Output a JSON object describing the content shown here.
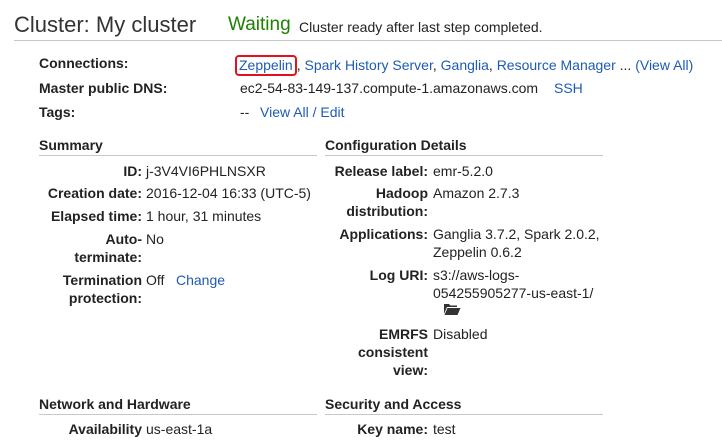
{
  "header": {
    "title": "Cluster: My cluster",
    "status": "Waiting",
    "status_message": "Cluster ready after last step completed.",
    "status_color": "#1d8102"
  },
  "connections": {
    "label": "Connections:",
    "links": [
      "Zeppelin",
      "Spark History Server",
      "Ganglia",
      "Resource Manager"
    ],
    "ellipsis": "...",
    "view_all": "(View All)",
    "highlight_color": "#e0121b"
  },
  "dns": {
    "label": "Master public DNS:",
    "value": "ec2-54-83-149-137.compute-1.amazonaws.com",
    "ssh": "SSH"
  },
  "tags": {
    "label": "Tags:",
    "value": "--",
    "link": "View All / Edit"
  },
  "summary": {
    "title": "Summary",
    "id_label": "ID:",
    "id_value": "j-3V4VI6PHLNSXR",
    "creation_label": "Creation date:",
    "creation_value": "2016-12-04 16:33 (UTC-5)",
    "elapsed_label": "Elapsed time:",
    "elapsed_value": "1 hour, 31 minutes",
    "autoterm_label_1": "Auto-",
    "autoterm_label_2": "terminate:",
    "autoterm_value": "No",
    "termprot_label_1": "Termination",
    "termprot_label_2": "protection:",
    "termprot_value": "Off",
    "termprot_change": "Change"
  },
  "config": {
    "title": "Configuration Details",
    "release_label": "Release label:",
    "release_value": "emr-5.2.0",
    "hadoop_label_1": "Hadoop",
    "hadoop_label_2": "distribution:",
    "hadoop_value": "Amazon 2.7.3",
    "apps_label": "Applications:",
    "apps_value_1": "Ganglia 3.7.2, Spark 2.0.2,",
    "apps_value_2": "Zeppelin 0.6.2",
    "loguri_label": "Log URI:",
    "loguri_value_1": "s3://aws-logs-",
    "loguri_value_2": "054255905277-us-east-1/",
    "emrfs_label_1": "EMRFS",
    "emrfs_label_2": "consistent",
    "emrfs_label_3": "view:",
    "emrfs_value": "Disabled"
  },
  "network": {
    "title": "Network and Hardware",
    "availability_label": "Availability",
    "availability_value": "us-east-1a"
  },
  "security": {
    "title": "Security and Access",
    "keyname_label": "Key name:",
    "keyname_value": "test"
  },
  "icons": {
    "folder": "folder-open-icon"
  }
}
